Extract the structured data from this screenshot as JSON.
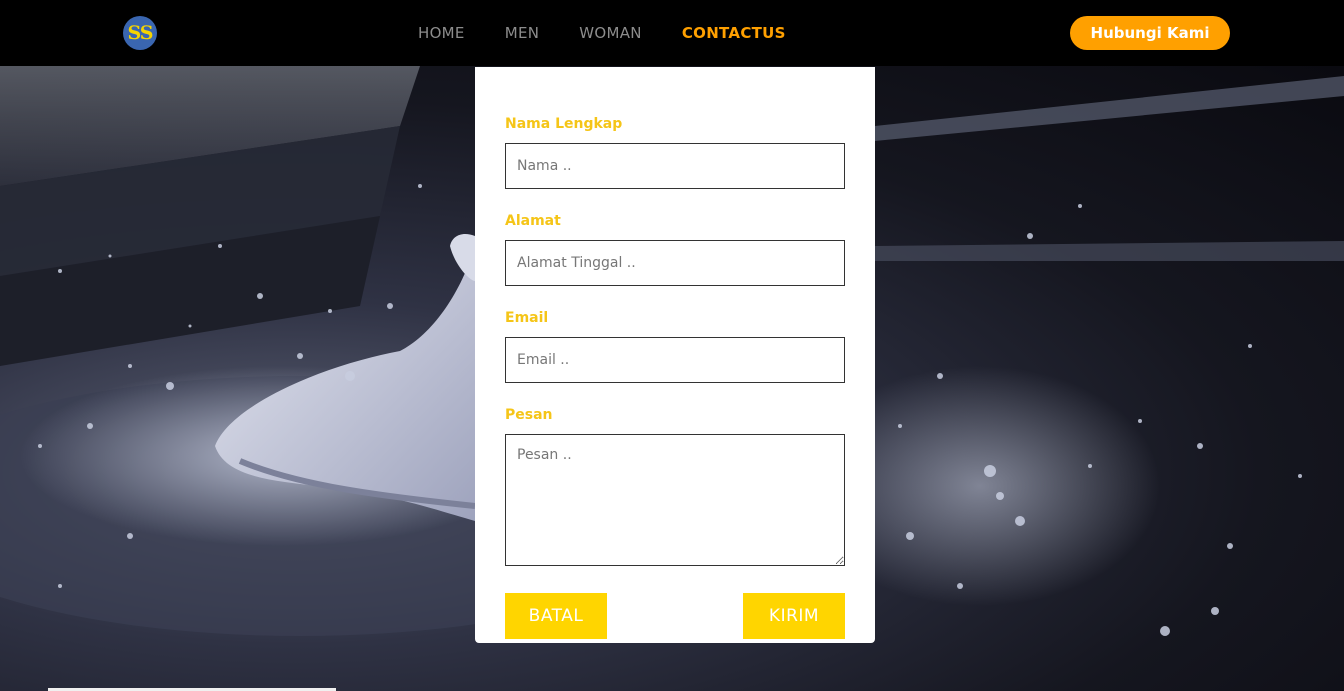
{
  "brand": {
    "logo_text": "SS"
  },
  "nav": {
    "items": [
      {
        "label": "HOME"
      },
      {
        "label": "MEN"
      },
      {
        "label": "WOMAN"
      },
      {
        "label": "CONTACTUS"
      }
    ],
    "cta_label": "Hubungi Kami"
  },
  "form": {
    "name": {
      "label": "Nama Lengkap",
      "placeholder": "Nama .."
    },
    "address": {
      "label": "Alamat",
      "placeholder": "Alamat Tinggal .."
    },
    "email": {
      "label": "Email",
      "placeholder": "Email .."
    },
    "message": {
      "label": "Pesan",
      "placeholder": "Pesan .."
    },
    "cancel_label": "BATAL",
    "submit_label": "KIRIM"
  },
  "colors": {
    "accent": "#ffa000",
    "label": "#f5c518",
    "button": "#ffd500",
    "navbar": "#000000"
  }
}
